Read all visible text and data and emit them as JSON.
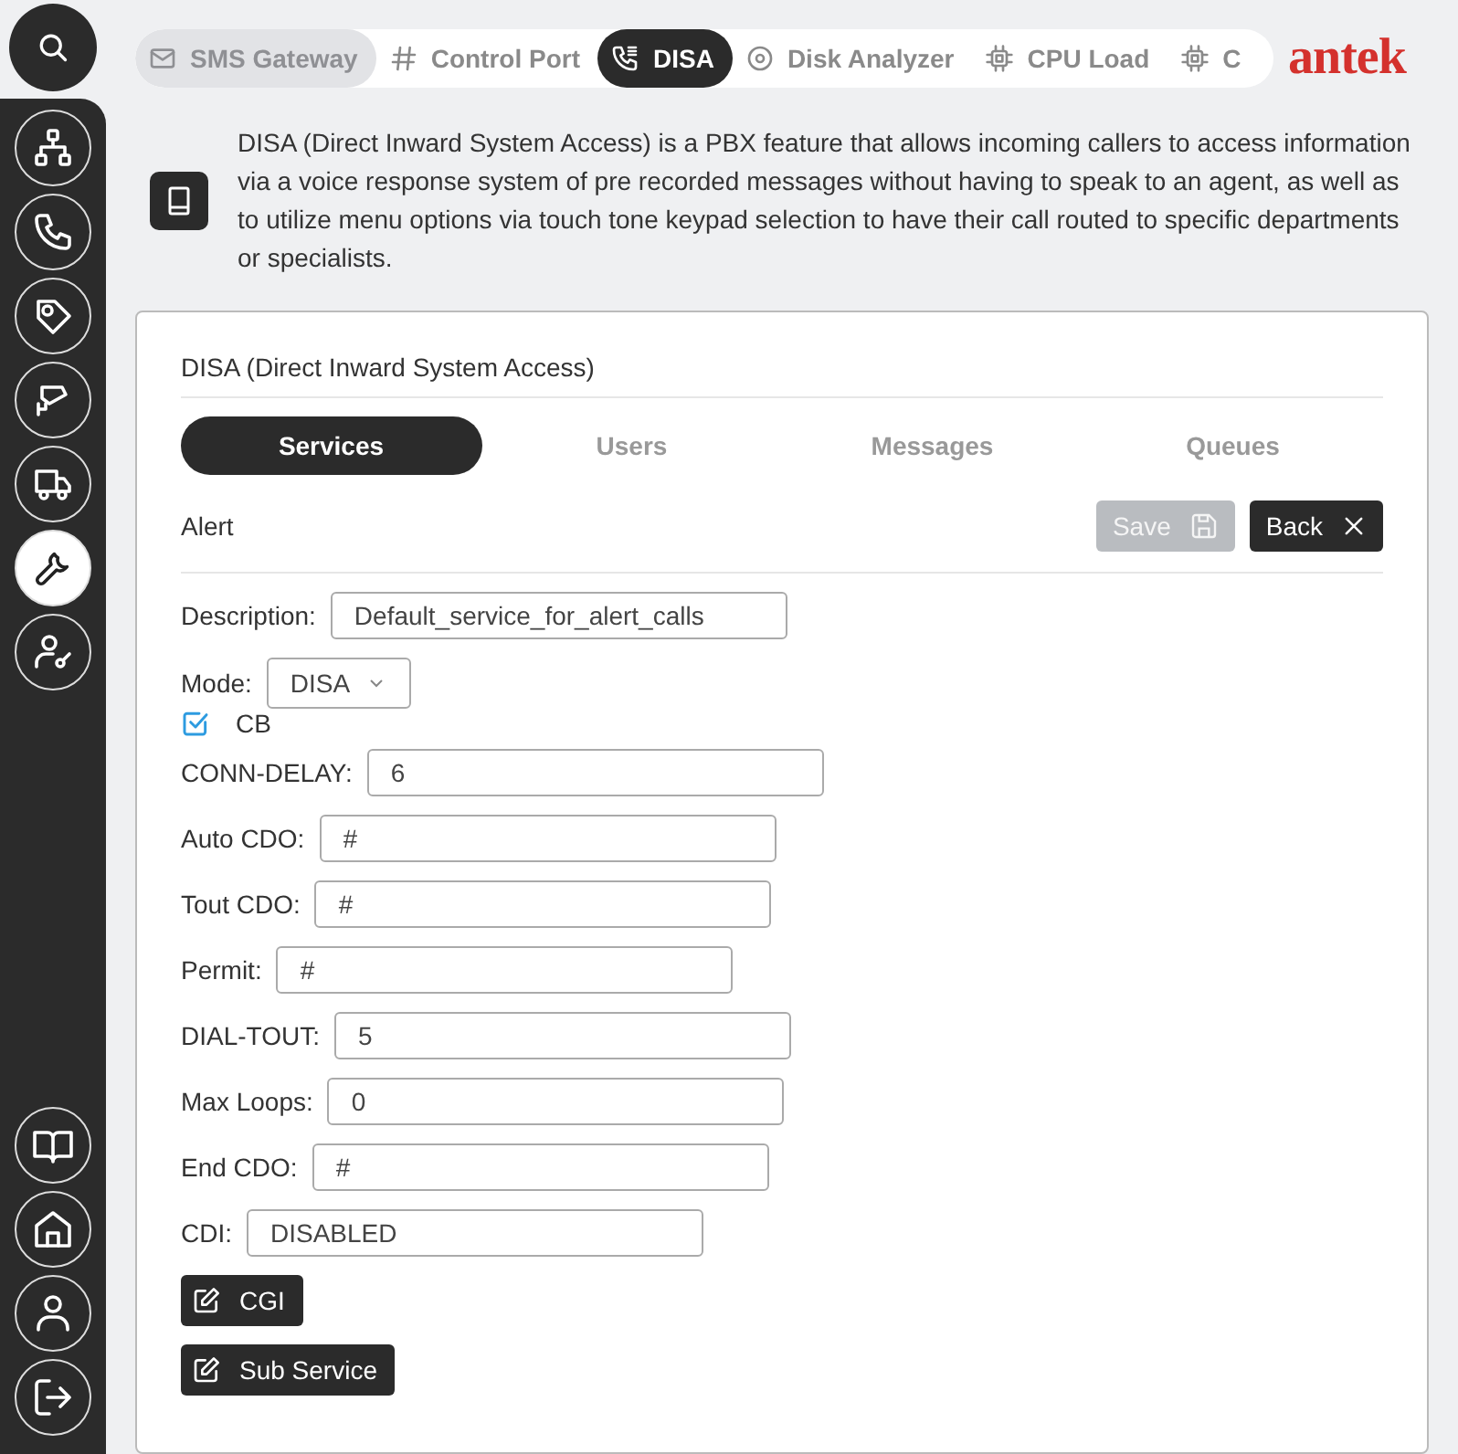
{
  "sidebar": {
    "top_items": [
      {
        "selected": false
      },
      {
        "selected": false
      },
      {
        "selected": false
      },
      {
        "selected": false
      },
      {
        "selected": false
      },
      {
        "selected": true
      },
      {
        "selected": false
      }
    ],
    "bottom_items": [
      {
        "selected": false
      },
      {
        "selected": false
      },
      {
        "selected": false
      },
      {
        "selected": false
      }
    ]
  },
  "tabs": [
    {
      "label": "SMS Gateway",
      "selected": false,
      "disabled": true
    },
    {
      "label": "Control Port",
      "selected": false,
      "disabled": false
    },
    {
      "label": "DISA",
      "selected": true,
      "disabled": false
    },
    {
      "label": "Disk Analyzer",
      "selected": false,
      "disabled": false
    },
    {
      "label": "CPU Load",
      "selected": false,
      "disabled": false
    },
    {
      "label": "C",
      "selected": false,
      "disabled": false
    }
  ],
  "logo": "antek",
  "intro": "DISA (Direct Inward System Access) is a PBX feature that allows incoming callers to access information via a voice response system of pre recorded messages without having to speak to an agent, as well as to utilize menu options via touch tone keypad selection to have their call routed to specific departments or specialists.",
  "card": {
    "title": "DISA (Direct Inward System Access)",
    "subtabs": [
      {
        "label": "Services",
        "selected": true
      },
      {
        "label": "Users",
        "selected": false
      },
      {
        "label": "Messages",
        "selected": false
      },
      {
        "label": "Queues",
        "selected": false
      }
    ],
    "section": "Alert",
    "save": {
      "label": "Save",
      "disabled": true
    },
    "back": {
      "label": "Back"
    },
    "fields": [
      {
        "kind": "text",
        "label": "Description:",
        "value": "Default_service_for_alert_calls"
      },
      {
        "kind": "select",
        "label": "Mode:",
        "value": "DISA"
      },
      {
        "kind": "checkbox",
        "label": "CB",
        "checked": true
      },
      {
        "kind": "text",
        "label": "CONN-DELAY:",
        "value": "6"
      },
      {
        "kind": "text",
        "label": "Auto CDO:",
        "value": "#"
      },
      {
        "kind": "text",
        "label": "Tout CDO:",
        "value": "#"
      },
      {
        "kind": "text",
        "label": "Permit:",
        "value": "#"
      },
      {
        "kind": "text",
        "label": "DIAL-TOUT:",
        "value": "5"
      },
      {
        "kind": "text",
        "label": "Max Loops:",
        "value": "0"
      },
      {
        "kind": "text",
        "label": "End CDO:",
        "value": "#"
      },
      {
        "kind": "text",
        "label": "CDI:",
        "value": "DISABLED"
      }
    ],
    "actions": [
      {
        "label": "CGI"
      },
      {
        "label": "Sub Service"
      }
    ]
  }
}
